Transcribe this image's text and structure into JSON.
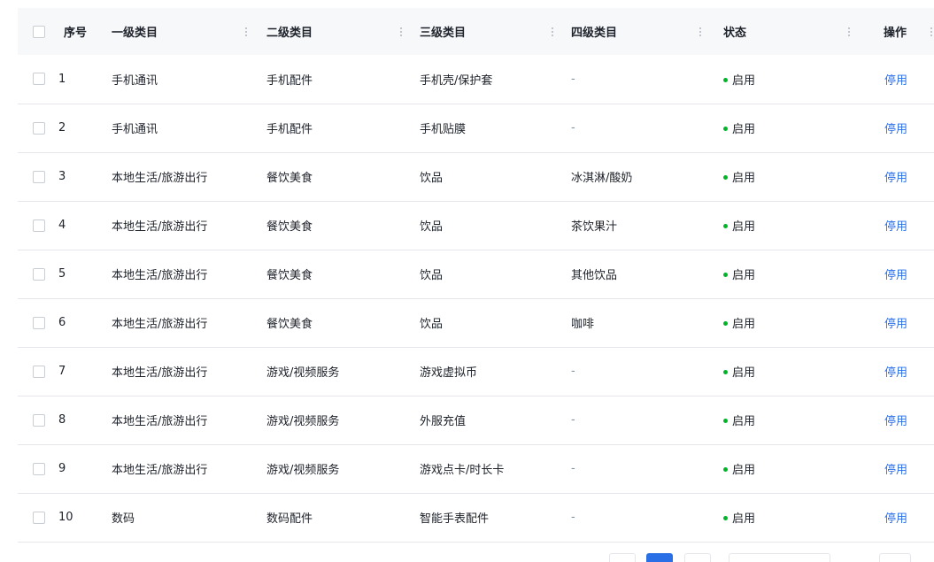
{
  "colors": {
    "status_enabled": "#00b42a",
    "link": "#2b6fe6",
    "header_bg": "#f7f8fa"
  },
  "table": {
    "columns": {
      "index": "序号",
      "level1": "一级类目",
      "level2": "二级类目",
      "level3": "三级类目",
      "level4": "四级类目",
      "status": "状态",
      "action": "操作"
    },
    "rows": [
      {
        "index": "1",
        "level1": "手机通讯",
        "level2": "手机配件",
        "level3": "手机壳/保护套",
        "level4": "-",
        "status": "启用",
        "action": "停用"
      },
      {
        "index": "2",
        "level1": "手机通讯",
        "level2": "手机配件",
        "level3": "手机贴膜",
        "level4": "-",
        "status": "启用",
        "action": "停用"
      },
      {
        "index": "3",
        "level1": "本地生活/旅游出行",
        "level2": "餐饮美食",
        "level3": "饮品",
        "level4": "冰淇淋/酸奶",
        "status": "启用",
        "action": "停用"
      },
      {
        "index": "4",
        "level1": "本地生活/旅游出行",
        "level2": "餐饮美食",
        "level3": "饮品",
        "level4": "茶饮果汁",
        "status": "启用",
        "action": "停用"
      },
      {
        "index": "5",
        "level1": "本地生活/旅游出行",
        "level2": "餐饮美食",
        "level3": "饮品",
        "level4": "其他饮品",
        "status": "启用",
        "action": "停用"
      },
      {
        "index": "6",
        "level1": "本地生活/旅游出行",
        "level2": "餐饮美食",
        "level3": "饮品",
        "level4": "咖啡",
        "status": "启用",
        "action": "停用"
      },
      {
        "index": "7",
        "level1": "本地生活/旅游出行",
        "level2": "游戏/视频服务",
        "level3": "游戏虚拟币",
        "level4": "-",
        "status": "启用",
        "action": "停用"
      },
      {
        "index": "8",
        "level1": "本地生活/旅游出行",
        "level2": "游戏/视频服务",
        "level3": "外服充值",
        "level4": "-",
        "status": "启用",
        "action": "停用"
      },
      {
        "index": "9",
        "level1": "本地生活/旅游出行",
        "level2": "游戏/视频服务",
        "level3": "游戏点卡/时长卡",
        "level4": "-",
        "status": "启用",
        "action": "停用"
      },
      {
        "index": "10",
        "level1": "数码",
        "level2": "数码配件",
        "level3": "智能手表配件",
        "level4": "-",
        "status": "启用",
        "action": "停用"
      }
    ]
  }
}
